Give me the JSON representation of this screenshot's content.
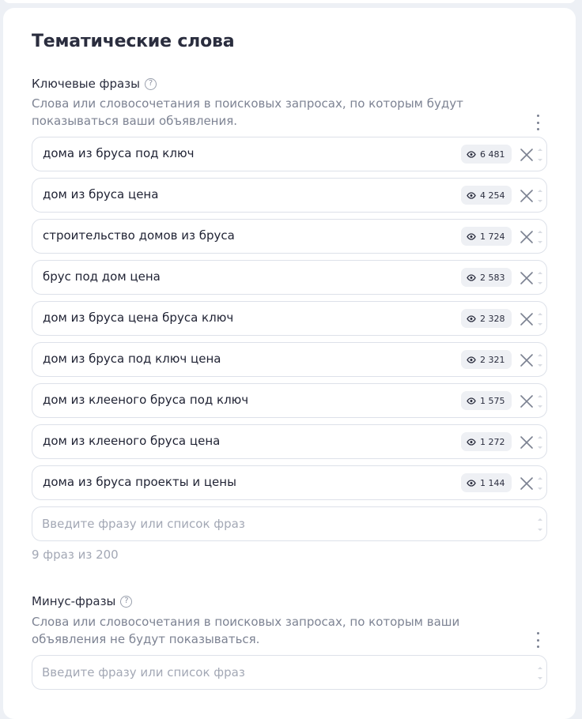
{
  "section": {
    "title": "Тематические слова"
  },
  "keywords": {
    "label": "Ключевые фразы",
    "help": "?",
    "description": "Слова или словосочетания в поисковых запросах, по которым будут показываться ваши объявления.",
    "phrases": [
      {
        "text": "дома из бруса под ключ",
        "count": "6 481"
      },
      {
        "text": "дом из бруса цена",
        "count": "4 254"
      },
      {
        "text": "строительство домов из бруса",
        "count": "1 724"
      },
      {
        "text": "брус под дом цена",
        "count": "2 583"
      },
      {
        "text": "дом из бруса цена бруса ключ",
        "count": "2 328"
      },
      {
        "text": "дом из бруса под ключ цена",
        "count": "2 321"
      },
      {
        "text": "дом из клееного бруса под ключ",
        "count": "1 575"
      },
      {
        "text": "дом из клееного бруса цена",
        "count": "1 272"
      },
      {
        "text": "дома из бруса проекты и цены",
        "count": "1 144"
      }
    ],
    "input_placeholder": "Введите фразу или список фраз",
    "counter": "9 фраз из 200"
  },
  "minus": {
    "label": "Минус-фразы",
    "help": "?",
    "description": "Слова или словосочетания в поисковых запросах, по которым ваши объявления не будут показываться.",
    "input_placeholder": "Введите фразу или список фраз"
  },
  "icons": {
    "help": "question-circle-icon",
    "menu": "kebab-menu-icon",
    "views": "eye-icon",
    "remove": "close-icon"
  }
}
